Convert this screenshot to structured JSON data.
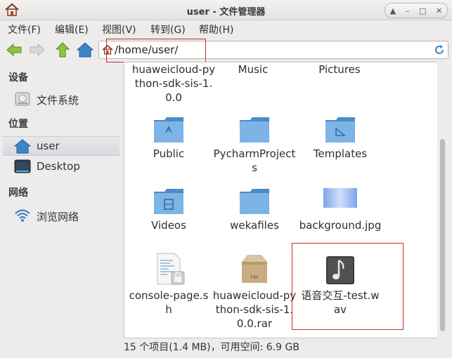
{
  "window": {
    "title": "user - 文件管理器",
    "controls": [
      "▲",
      "–",
      "□",
      "✕"
    ]
  },
  "menu": [
    {
      "label": "文件(F)",
      "key": "F"
    },
    {
      "label": "编辑(E)",
      "key": "E"
    },
    {
      "label": "视图(V)",
      "key": "V"
    },
    {
      "label": "转到(G)",
      "key": "G"
    },
    {
      "label": "帮助(H)",
      "key": "H"
    }
  ],
  "location": {
    "path": "/home/user/"
  },
  "sidebar": {
    "devices_header": "设备",
    "filesystem": "文件系统",
    "places_header": "位置",
    "user": "user",
    "desktop": "Desktop",
    "network_header": "网络",
    "browse_network": "浏览网络"
  },
  "files": {
    "huaweicloud_sdk": "huaweicloud-python-sdk-sis-1.0.0",
    "music": "Music",
    "pictures": "Pictures",
    "public": "Public",
    "pycharm": "PycharmProjects",
    "templates": "Templates",
    "videos": "Videos",
    "wekafiles": "wekafiles",
    "background": "background.jpg",
    "console": "console-page.sh",
    "rar": "huaweicloud-python-sdk-sis-1.0.0.rar",
    "wav": "语音交互-test.wav"
  },
  "status": "15 个项目(1.4 MB)，可用空间: 6.9 GB",
  "colors": {
    "folder": "#5c9fd6",
    "highlight": "#d12828",
    "accent": "#3a84c9"
  }
}
